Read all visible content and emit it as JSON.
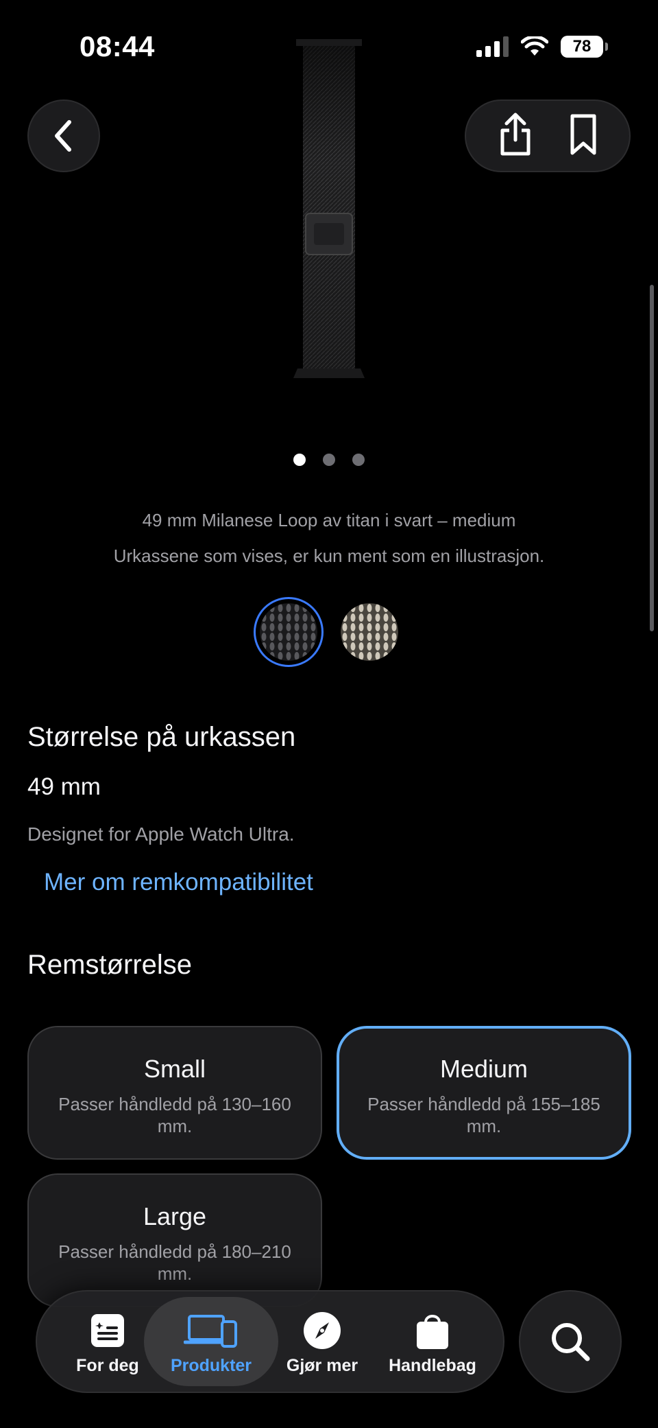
{
  "status": {
    "time": "08:44",
    "battery": "78"
  },
  "nav": {
    "back_icon": "chevron-left-icon",
    "share_icon": "share-icon",
    "bookmark_icon": "bookmark-icon"
  },
  "product": {
    "name": "49 mm Milanese Loop av titan i svart – medium",
    "disclaimer": "Urkassene som vises, er kun ment som en illustrasjon.",
    "image_count": 3,
    "active_image": 1,
    "colors": [
      {
        "name": "black-titanium",
        "hex": "#3a3a3c",
        "selected": true
      },
      {
        "name": "natural-titanium",
        "hex": "#b8b2a6",
        "selected": false
      }
    ]
  },
  "case_size": {
    "title": "Størrelse på urkassen",
    "value": "49 mm",
    "note": "Designet for Apple Watch Ultra.",
    "link": "Mer om remkompatibilitet"
  },
  "band_size": {
    "title": "Remstørrelse",
    "options": [
      {
        "label": "Small",
        "desc": "Passer håndledd på 130–160 mm.",
        "selected": false
      },
      {
        "label": "Medium",
        "desc": "Passer håndledd på 155–185 mm.",
        "selected": true
      },
      {
        "label": "Large",
        "desc": "Passer håndledd på 180–210 mm.",
        "selected": false
      }
    ]
  },
  "tabs": [
    {
      "label": "For deg",
      "icon": "for-you-icon",
      "active": false
    },
    {
      "label": "Produkter",
      "icon": "products-icon",
      "active": true
    },
    {
      "label": "Gjør mer",
      "icon": "compass-icon",
      "active": false
    },
    {
      "label": "Handlebag",
      "icon": "bag-icon",
      "active": false
    }
  ],
  "search_icon": "search-icon",
  "colors": {
    "accent": "#4fa3ff",
    "link": "#6eb4ff",
    "selected_border": "#62aef7",
    "card_bg": "#1c1c1e"
  }
}
